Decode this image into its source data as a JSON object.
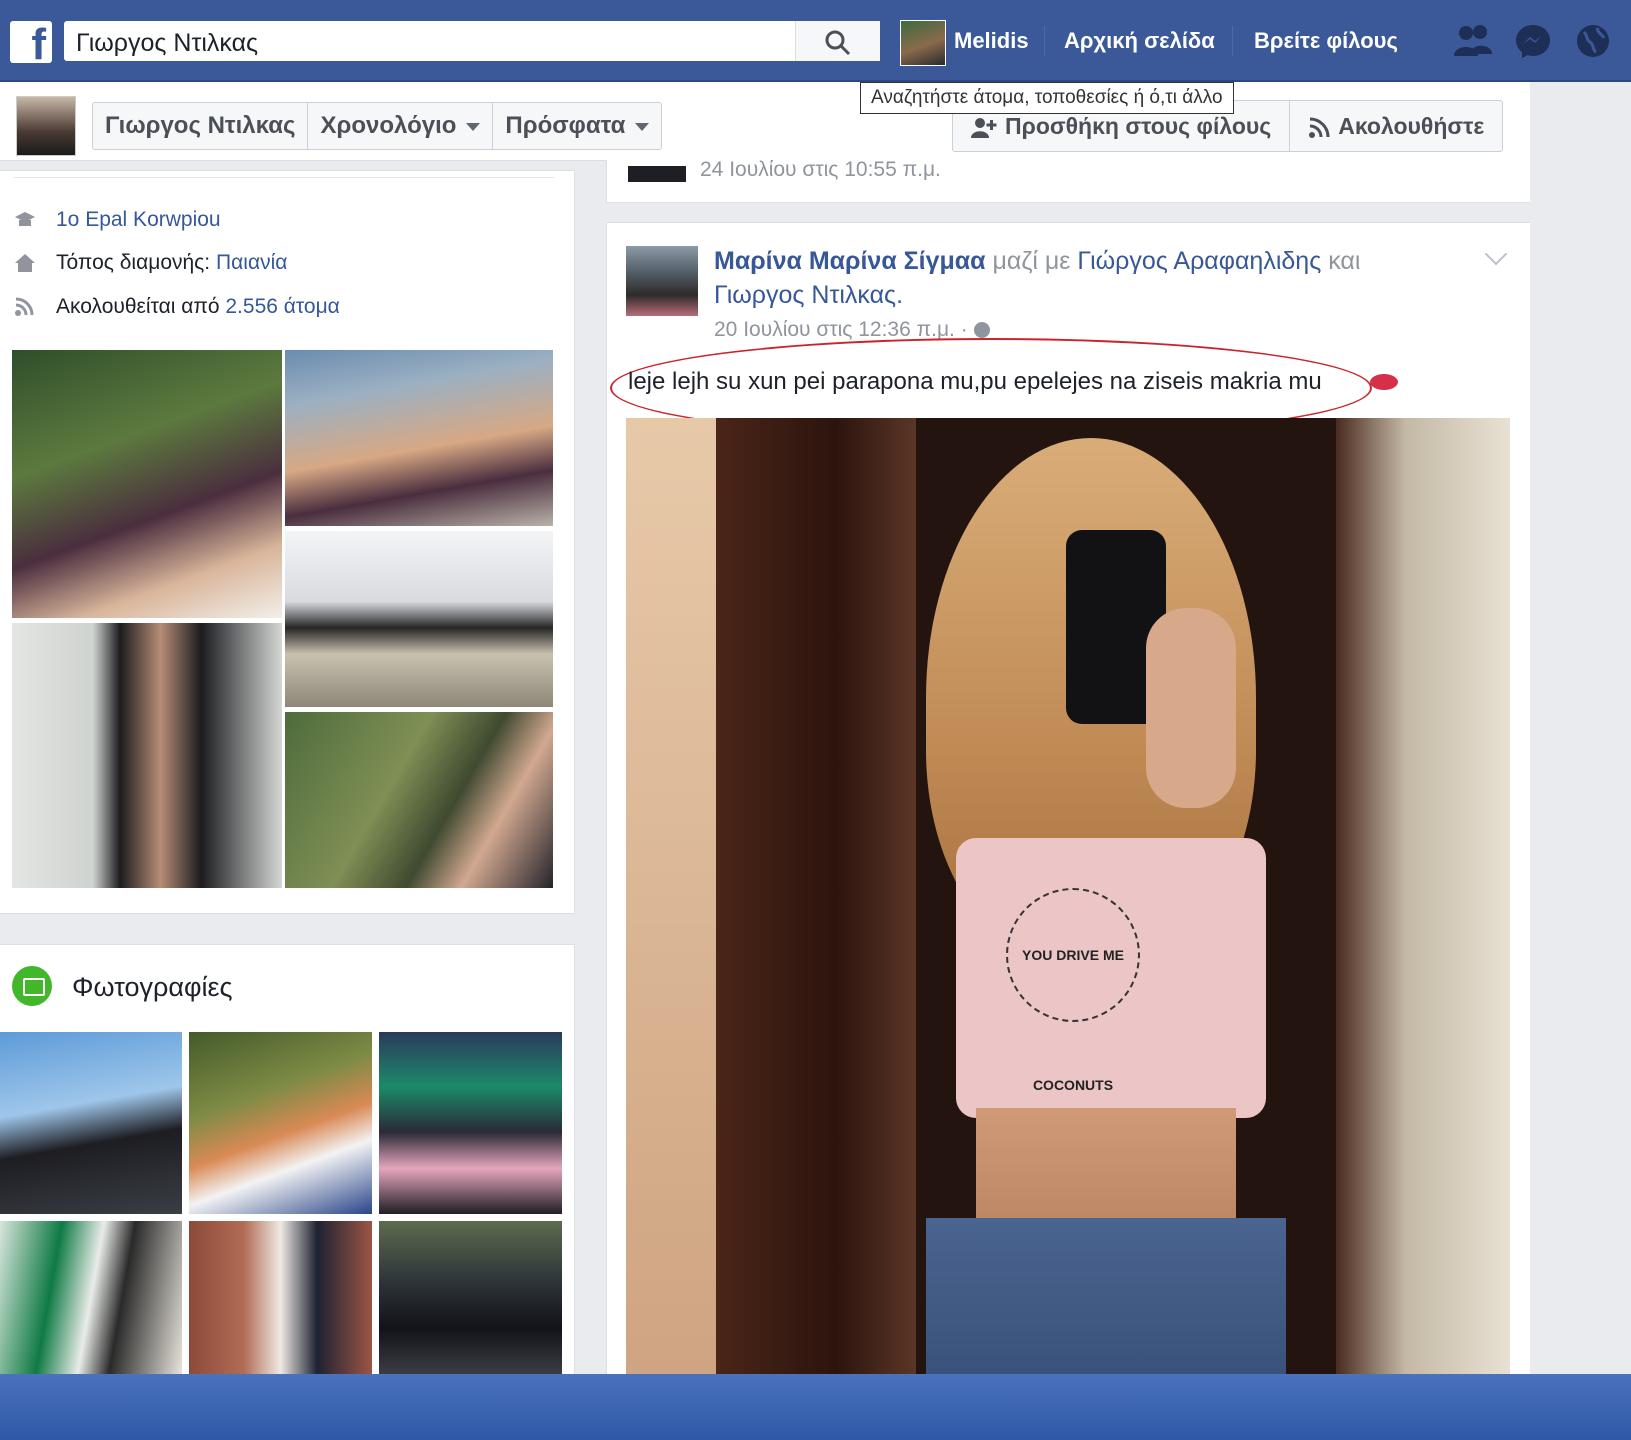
{
  "topbar": {
    "logo": "f",
    "search_value": "Γιωργος Ντιλκας",
    "user_name": "Melidis",
    "home": "Αρχική σελίδα",
    "find_friends": "Βρείτε φίλους",
    "icons": [
      "friend-requests-icon",
      "messenger-icon",
      "notifications-globe-icon"
    ]
  },
  "tooltip": "Αναζητήστε άτομα, τοποθεσίες ή ό,τι άλλο",
  "profile_bar": {
    "name": "Γιωργος Ντιλκας",
    "timeline": "Χρονολόγιο",
    "recent": "Πρόσφατα",
    "add_friend": "Προσθήκη στους φίλους",
    "follow": "Ακολουθήστε"
  },
  "intro": {
    "school": "1o Epal Korwpiou",
    "lives_label": "Τόπος διαμονής:",
    "lives_value": "Παιανία",
    "followed_label": "Ακολουθείται από",
    "followed_value": "2.556 άτομα"
  },
  "photos": {
    "title": "Φωτογραφίες"
  },
  "prev_post": {
    "timestamp": "24 Ιουλίου στις 10:55 π.μ."
  },
  "post": {
    "author": "Μαρίνα Μαρίνα Σίγμαα",
    "with": "μαζί με",
    "tag1": "Γιώργος Αραφαηλιδης",
    "and": "και",
    "tag2": "Γιωργος Ντιλκας",
    "timestamp": "20 Ιουλίου στις 12:36 π.μ. ·",
    "text": "leje lejh su xun pei parapona mu,pu epelejes na ziseis makria mu",
    "shirt_text": "YOU DRIVE ME COCONUTS"
  },
  "colors": {
    "brand": "#3b5998",
    "link": "#365899",
    "annotation": "#c9252c"
  }
}
